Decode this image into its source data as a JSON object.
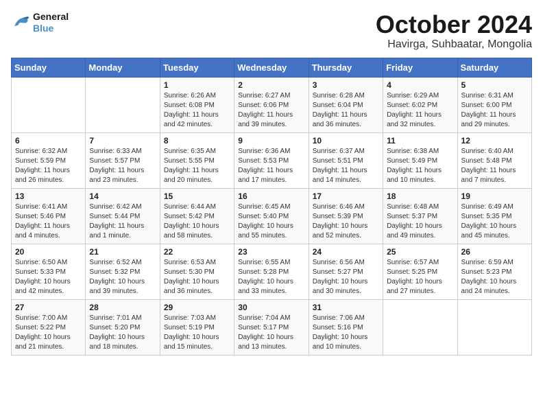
{
  "logo": {
    "line1": "General",
    "line2": "Blue"
  },
  "title": "October 2024",
  "subtitle": "Havirga, Suhbaatar, Mongolia",
  "days_of_week": [
    "Sunday",
    "Monday",
    "Tuesday",
    "Wednesday",
    "Thursday",
    "Friday",
    "Saturday"
  ],
  "weeks": [
    [
      {
        "day": "",
        "sunrise": "",
        "sunset": "",
        "daylight": ""
      },
      {
        "day": "",
        "sunrise": "",
        "sunset": "",
        "daylight": ""
      },
      {
        "day": "1",
        "sunrise": "Sunrise: 6:26 AM",
        "sunset": "Sunset: 6:08 PM",
        "daylight": "Daylight: 11 hours and 42 minutes."
      },
      {
        "day": "2",
        "sunrise": "Sunrise: 6:27 AM",
        "sunset": "Sunset: 6:06 PM",
        "daylight": "Daylight: 11 hours and 39 minutes."
      },
      {
        "day": "3",
        "sunrise": "Sunrise: 6:28 AM",
        "sunset": "Sunset: 6:04 PM",
        "daylight": "Daylight: 11 hours and 36 minutes."
      },
      {
        "day": "4",
        "sunrise": "Sunrise: 6:29 AM",
        "sunset": "Sunset: 6:02 PM",
        "daylight": "Daylight: 11 hours and 32 minutes."
      },
      {
        "day": "5",
        "sunrise": "Sunrise: 6:31 AM",
        "sunset": "Sunset: 6:00 PM",
        "daylight": "Daylight: 11 hours and 29 minutes."
      }
    ],
    [
      {
        "day": "6",
        "sunrise": "Sunrise: 6:32 AM",
        "sunset": "Sunset: 5:59 PM",
        "daylight": "Daylight: 11 hours and 26 minutes."
      },
      {
        "day": "7",
        "sunrise": "Sunrise: 6:33 AM",
        "sunset": "Sunset: 5:57 PM",
        "daylight": "Daylight: 11 hours and 23 minutes."
      },
      {
        "day": "8",
        "sunrise": "Sunrise: 6:35 AM",
        "sunset": "Sunset: 5:55 PM",
        "daylight": "Daylight: 11 hours and 20 minutes."
      },
      {
        "day": "9",
        "sunrise": "Sunrise: 6:36 AM",
        "sunset": "Sunset: 5:53 PM",
        "daylight": "Daylight: 11 hours and 17 minutes."
      },
      {
        "day": "10",
        "sunrise": "Sunrise: 6:37 AM",
        "sunset": "Sunset: 5:51 PM",
        "daylight": "Daylight: 11 hours and 14 minutes."
      },
      {
        "day": "11",
        "sunrise": "Sunrise: 6:38 AM",
        "sunset": "Sunset: 5:49 PM",
        "daylight": "Daylight: 11 hours and 10 minutes."
      },
      {
        "day": "12",
        "sunrise": "Sunrise: 6:40 AM",
        "sunset": "Sunset: 5:48 PM",
        "daylight": "Daylight: 11 hours and 7 minutes."
      }
    ],
    [
      {
        "day": "13",
        "sunrise": "Sunrise: 6:41 AM",
        "sunset": "Sunset: 5:46 PM",
        "daylight": "Daylight: 11 hours and 4 minutes."
      },
      {
        "day": "14",
        "sunrise": "Sunrise: 6:42 AM",
        "sunset": "Sunset: 5:44 PM",
        "daylight": "Daylight: 11 hours and 1 minute."
      },
      {
        "day": "15",
        "sunrise": "Sunrise: 6:44 AM",
        "sunset": "Sunset: 5:42 PM",
        "daylight": "Daylight: 10 hours and 58 minutes."
      },
      {
        "day": "16",
        "sunrise": "Sunrise: 6:45 AM",
        "sunset": "Sunset: 5:40 PM",
        "daylight": "Daylight: 10 hours and 55 minutes."
      },
      {
        "day": "17",
        "sunrise": "Sunrise: 6:46 AM",
        "sunset": "Sunset: 5:39 PM",
        "daylight": "Daylight: 10 hours and 52 minutes."
      },
      {
        "day": "18",
        "sunrise": "Sunrise: 6:48 AM",
        "sunset": "Sunset: 5:37 PM",
        "daylight": "Daylight: 10 hours and 49 minutes."
      },
      {
        "day": "19",
        "sunrise": "Sunrise: 6:49 AM",
        "sunset": "Sunset: 5:35 PM",
        "daylight": "Daylight: 10 hours and 45 minutes."
      }
    ],
    [
      {
        "day": "20",
        "sunrise": "Sunrise: 6:50 AM",
        "sunset": "Sunset: 5:33 PM",
        "daylight": "Daylight: 10 hours and 42 minutes."
      },
      {
        "day": "21",
        "sunrise": "Sunrise: 6:52 AM",
        "sunset": "Sunset: 5:32 PM",
        "daylight": "Daylight: 10 hours and 39 minutes."
      },
      {
        "day": "22",
        "sunrise": "Sunrise: 6:53 AM",
        "sunset": "Sunset: 5:30 PM",
        "daylight": "Daylight: 10 hours and 36 minutes."
      },
      {
        "day": "23",
        "sunrise": "Sunrise: 6:55 AM",
        "sunset": "Sunset: 5:28 PM",
        "daylight": "Daylight: 10 hours and 33 minutes."
      },
      {
        "day": "24",
        "sunrise": "Sunrise: 6:56 AM",
        "sunset": "Sunset: 5:27 PM",
        "daylight": "Daylight: 10 hours and 30 minutes."
      },
      {
        "day": "25",
        "sunrise": "Sunrise: 6:57 AM",
        "sunset": "Sunset: 5:25 PM",
        "daylight": "Daylight: 10 hours and 27 minutes."
      },
      {
        "day": "26",
        "sunrise": "Sunrise: 6:59 AM",
        "sunset": "Sunset: 5:23 PM",
        "daylight": "Daylight: 10 hours and 24 minutes."
      }
    ],
    [
      {
        "day": "27",
        "sunrise": "Sunrise: 7:00 AM",
        "sunset": "Sunset: 5:22 PM",
        "daylight": "Daylight: 10 hours and 21 minutes."
      },
      {
        "day": "28",
        "sunrise": "Sunrise: 7:01 AM",
        "sunset": "Sunset: 5:20 PM",
        "daylight": "Daylight: 10 hours and 18 minutes."
      },
      {
        "day": "29",
        "sunrise": "Sunrise: 7:03 AM",
        "sunset": "Sunset: 5:19 PM",
        "daylight": "Daylight: 10 hours and 15 minutes."
      },
      {
        "day": "30",
        "sunrise": "Sunrise: 7:04 AM",
        "sunset": "Sunset: 5:17 PM",
        "daylight": "Daylight: 10 hours and 13 minutes."
      },
      {
        "day": "31",
        "sunrise": "Sunrise: 7:06 AM",
        "sunset": "Sunset: 5:16 PM",
        "daylight": "Daylight: 10 hours and 10 minutes."
      },
      {
        "day": "",
        "sunrise": "",
        "sunset": "",
        "daylight": ""
      },
      {
        "day": "",
        "sunrise": "",
        "sunset": "",
        "daylight": ""
      }
    ]
  ]
}
